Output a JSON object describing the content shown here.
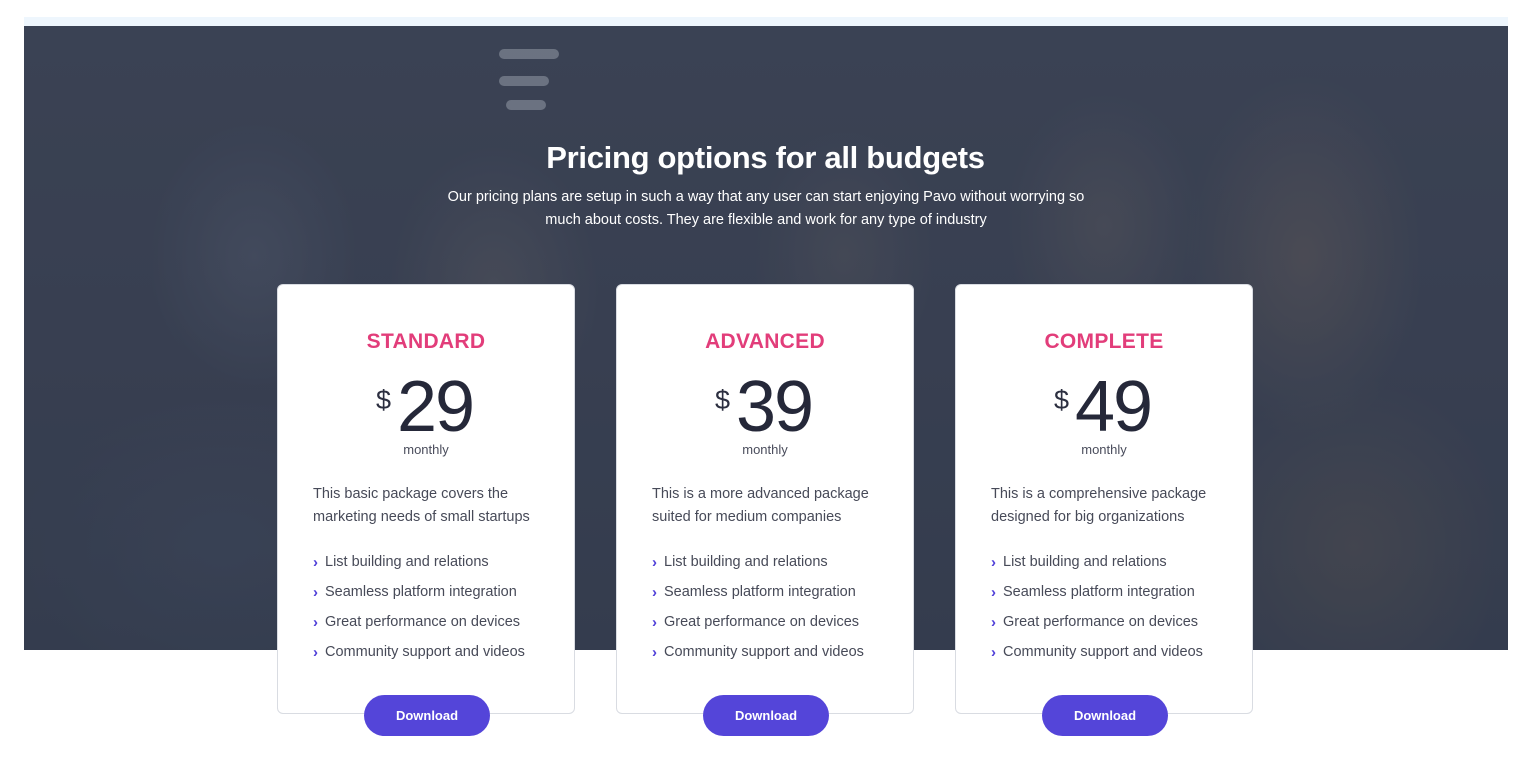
{
  "hero": {
    "title": "Pricing options for all budgets",
    "subtitle": "Our pricing plans are setup in such a way that any user can start enjoying Pavo without worrying so much about costs. They are flexible and work for any type of industry"
  },
  "plans": [
    {
      "name": "STANDARD",
      "currency": "$",
      "price": "29",
      "period": "monthly",
      "description": "This basic package covers the marketing needs of small startups",
      "features": [
        "List building and relations",
        "Seamless platform integration",
        "Great performance on devices",
        "Community support and videos"
      ],
      "button_label": "Download"
    },
    {
      "name": "ADVANCED",
      "currency": "$",
      "price": "39",
      "period": "monthly",
      "description": "This is a more advanced package suited for medium companies",
      "features": [
        "List building and relations",
        "Seamless platform integration",
        "Great performance on devices",
        "Community support and videos"
      ],
      "button_label": "Download"
    },
    {
      "name": "COMPLETE",
      "currency": "$",
      "price": "49",
      "period": "monthly",
      "description": "This is a comprehensive package designed for big organizations",
      "features": [
        "List building and relations",
        "Seamless platform integration",
        "Great performance on devices",
        "Community support and videos"
      ],
      "button_label": "Download"
    }
  ],
  "icons": {
    "feature_bullet": "chevron-right-icon"
  },
  "colors": {
    "accent": "#5445d9",
    "plan_name": "#e23d7a",
    "price_text": "#252839"
  }
}
